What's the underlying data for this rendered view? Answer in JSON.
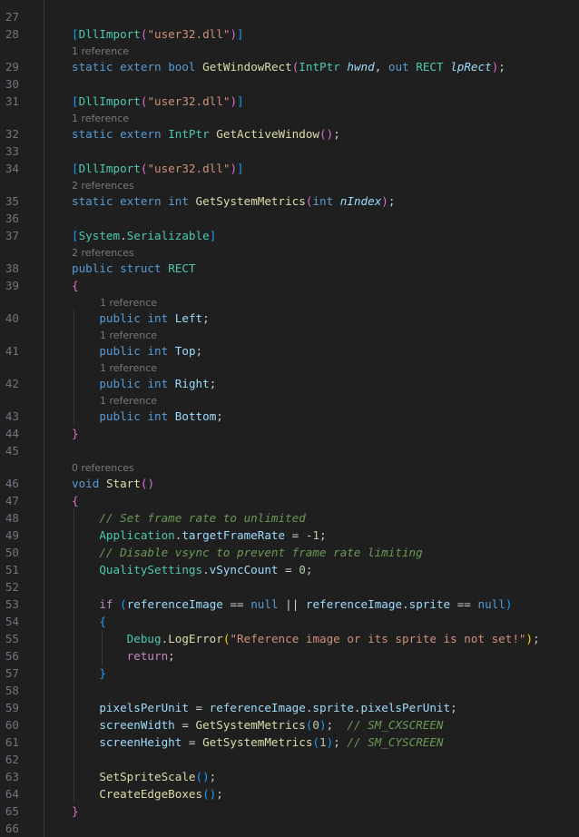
{
  "editor": {
    "language": "csharp",
    "theme_colors": {
      "background": "#1f1f1f",
      "line_number": "#6e7681",
      "keyword": "#569cd6",
      "control_keyword": "#c586c0",
      "type": "#4ec9b0",
      "function": "#dcdcaa",
      "string": "#ce9178",
      "number": "#b5cea8",
      "variable": "#9cdcfe",
      "comment": "#6a9955",
      "codelens": "#7a7a7a",
      "bracket_level_1": "#ffd700",
      "bracket_level_2": "#da70d6",
      "bracket_level_3": "#179fff"
    },
    "lines": [
      {
        "n": "",
        "tokens": []
      },
      {
        "n": "27",
        "tokens": []
      },
      {
        "n": "28",
        "tokens": [
          [
            "b3",
            "["
          ],
          [
            "type",
            "DllImport"
          ],
          [
            "b2",
            "("
          ],
          [
            "str",
            "\"user32.dll\""
          ],
          [
            "b2",
            ")"
          ],
          [
            "b3",
            "]"
          ]
        ]
      },
      {
        "n": "29",
        "tokens": [
          [
            "kw",
            "static"
          ],
          [
            "pl",
            " "
          ],
          [
            "kw",
            "extern"
          ],
          [
            "pl",
            " "
          ],
          [
            "kw",
            "bool"
          ],
          [
            "pl",
            " "
          ],
          [
            "fn",
            "GetWindowRect"
          ],
          [
            "b2",
            "("
          ],
          [
            "type",
            "IntPtr"
          ],
          [
            "pl",
            " "
          ],
          [
            "par",
            "hwnd"
          ],
          [
            "pl",
            ", "
          ],
          [
            "kw",
            "out"
          ],
          [
            "pl",
            " "
          ],
          [
            "type",
            "RECT"
          ],
          [
            "pl",
            " "
          ],
          [
            "par",
            "lpRect"
          ],
          [
            "b2",
            ")"
          ],
          [
            "pl",
            ";"
          ]
        ]
      },
      {
        "n": "30",
        "tokens": []
      },
      {
        "n": "31",
        "tokens": [
          [
            "b3",
            "["
          ],
          [
            "type",
            "DllImport"
          ],
          [
            "b2",
            "("
          ],
          [
            "str",
            "\"user32.dll\""
          ],
          [
            "b2",
            ")"
          ],
          [
            "b3",
            "]"
          ]
        ]
      },
      {
        "n": "32",
        "tokens": [
          [
            "kw",
            "static"
          ],
          [
            "pl",
            " "
          ],
          [
            "kw",
            "extern"
          ],
          [
            "pl",
            " "
          ],
          [
            "type",
            "IntPtr"
          ],
          [
            "pl",
            " "
          ],
          [
            "fn",
            "GetActiveWindow"
          ],
          [
            "b2",
            "()"
          ],
          [
            "pl",
            ";"
          ]
        ]
      },
      {
        "n": "33",
        "tokens": []
      },
      {
        "n": "34",
        "tokens": [
          [
            "b3",
            "["
          ],
          [
            "type",
            "DllImport"
          ],
          [
            "b2",
            "("
          ],
          [
            "str",
            "\"user32.dll\""
          ],
          [
            "b2",
            ")"
          ],
          [
            "b3",
            "]"
          ]
        ]
      },
      {
        "n": "35",
        "tokens": [
          [
            "kw",
            "static"
          ],
          [
            "pl",
            " "
          ],
          [
            "kw",
            "extern"
          ],
          [
            "pl",
            " "
          ],
          [
            "kw",
            "int"
          ],
          [
            "pl",
            " "
          ],
          [
            "fn",
            "GetSystemMetrics"
          ],
          [
            "b2",
            "("
          ],
          [
            "kw",
            "int"
          ],
          [
            "pl",
            " "
          ],
          [
            "par",
            "nIndex"
          ],
          [
            "b2",
            ")"
          ],
          [
            "pl",
            ";"
          ]
        ]
      },
      {
        "n": "36",
        "tokens": []
      },
      {
        "n": "37",
        "tokens": [
          [
            "b3",
            "["
          ],
          [
            "type",
            "System"
          ],
          [
            "pl",
            "."
          ],
          [
            "type",
            "Serializable"
          ],
          [
            "b3",
            "]"
          ]
        ]
      },
      {
        "n": "38",
        "tokens": [
          [
            "kw",
            "public"
          ],
          [
            "pl",
            " "
          ],
          [
            "kw",
            "struct"
          ],
          [
            "pl",
            " "
          ],
          [
            "type",
            "RECT"
          ]
        ]
      },
      {
        "n": "39",
        "tokens": [
          [
            "b2",
            "{"
          ]
        ]
      },
      {
        "n": "40",
        "tokens": [
          [
            "pl",
            "    "
          ],
          [
            "kw",
            "public"
          ],
          [
            "pl",
            " "
          ],
          [
            "kw",
            "int"
          ],
          [
            "pl",
            " "
          ],
          [
            "prop",
            "Left"
          ],
          [
            "pl",
            ";"
          ]
        ]
      },
      {
        "n": "41",
        "tokens": [
          [
            "pl",
            "    "
          ],
          [
            "kw",
            "public"
          ],
          [
            "pl",
            " "
          ],
          [
            "kw",
            "int"
          ],
          [
            "pl",
            " "
          ],
          [
            "prop",
            "Top"
          ],
          [
            "pl",
            ";"
          ]
        ]
      },
      {
        "n": "42",
        "tokens": [
          [
            "pl",
            "    "
          ],
          [
            "kw",
            "public"
          ],
          [
            "pl",
            " "
          ],
          [
            "kw",
            "int"
          ],
          [
            "pl",
            " "
          ],
          [
            "prop",
            "Right"
          ],
          [
            "pl",
            ";"
          ]
        ]
      },
      {
        "n": "43",
        "tokens": [
          [
            "pl",
            "    "
          ],
          [
            "kw",
            "public"
          ],
          [
            "pl",
            " "
          ],
          [
            "kw",
            "int"
          ],
          [
            "pl",
            " "
          ],
          [
            "prop",
            "Bottom"
          ],
          [
            "pl",
            ";"
          ]
        ]
      },
      {
        "n": "44",
        "tokens": [
          [
            "b2",
            "}"
          ]
        ]
      },
      {
        "n": "45",
        "tokens": []
      },
      {
        "n": "46",
        "tokens": [
          [
            "kw",
            "void"
          ],
          [
            "pl",
            " "
          ],
          [
            "fn",
            "Start"
          ],
          [
            "b2",
            "()"
          ]
        ]
      },
      {
        "n": "47",
        "tokens": [
          [
            "b2",
            "{"
          ]
        ]
      },
      {
        "n": "48",
        "tokens": [
          [
            "pl",
            "    "
          ],
          [
            "cmt",
            "// Set frame rate to unlimited"
          ]
        ]
      },
      {
        "n": "49",
        "tokens": [
          [
            "pl",
            "    "
          ],
          [
            "type",
            "Application"
          ],
          [
            "pl",
            "."
          ],
          [
            "prop",
            "targetFrameRate"
          ],
          [
            "pl",
            " = -"
          ],
          [
            "num",
            "1"
          ],
          [
            "pl",
            ";"
          ]
        ]
      },
      {
        "n": "50",
        "tokens": [
          [
            "pl",
            "    "
          ],
          [
            "cmt",
            "// Disable vsync to prevent frame rate limiting"
          ]
        ]
      },
      {
        "n": "51",
        "tokens": [
          [
            "pl",
            "    "
          ],
          [
            "type",
            "QualitySettings"
          ],
          [
            "pl",
            "."
          ],
          [
            "prop",
            "vSyncCount"
          ],
          [
            "pl",
            " = "
          ],
          [
            "num",
            "0"
          ],
          [
            "pl",
            ";"
          ]
        ]
      },
      {
        "n": "52",
        "tokens": []
      },
      {
        "n": "53",
        "tokens": [
          [
            "pl",
            "    "
          ],
          [
            "ctl",
            "if"
          ],
          [
            "pl",
            " "
          ],
          [
            "b3",
            "("
          ],
          [
            "prop",
            "referenceImage"
          ],
          [
            "pl",
            " == "
          ],
          [
            "kw",
            "null"
          ],
          [
            "pl",
            " || "
          ],
          [
            "prop",
            "referenceImage"
          ],
          [
            "pl",
            "."
          ],
          [
            "prop",
            "sprite"
          ],
          [
            "pl",
            " == "
          ],
          [
            "kw",
            "null"
          ],
          [
            "b3",
            ")"
          ]
        ]
      },
      {
        "n": "54",
        "tokens": [
          [
            "pl",
            "    "
          ],
          [
            "b3",
            "{"
          ]
        ]
      },
      {
        "n": "55",
        "tokens": [
          [
            "pl",
            "        "
          ],
          [
            "type",
            "Debug"
          ],
          [
            "pl",
            "."
          ],
          [
            "fn",
            "LogError"
          ],
          [
            "b1",
            "("
          ],
          [
            "str",
            "\"Reference image or its sprite is not set!\""
          ],
          [
            "b1",
            ")"
          ],
          [
            "pl",
            ";"
          ]
        ]
      },
      {
        "n": "56",
        "tokens": [
          [
            "pl",
            "        "
          ],
          [
            "ctl",
            "return"
          ],
          [
            "pl",
            ";"
          ]
        ]
      },
      {
        "n": "57",
        "tokens": [
          [
            "pl",
            "    "
          ],
          [
            "b3",
            "}"
          ]
        ]
      },
      {
        "n": "58",
        "tokens": []
      },
      {
        "n": "59",
        "tokens": [
          [
            "pl",
            "    "
          ],
          [
            "prop",
            "pixelsPerUnit"
          ],
          [
            "pl",
            " = "
          ],
          [
            "prop",
            "referenceImage"
          ],
          [
            "pl",
            "."
          ],
          [
            "prop",
            "sprite"
          ],
          [
            "pl",
            "."
          ],
          [
            "prop",
            "pixelsPerUnit"
          ],
          [
            "pl",
            ";"
          ]
        ]
      },
      {
        "n": "60",
        "tokens": [
          [
            "pl",
            "    "
          ],
          [
            "prop",
            "screenWidth"
          ],
          [
            "pl",
            " = "
          ],
          [
            "fn",
            "GetSystemMetrics"
          ],
          [
            "b3",
            "("
          ],
          [
            "num",
            "0"
          ],
          [
            "b3",
            ")"
          ],
          [
            "pl",
            ";  "
          ],
          [
            "cmt",
            "// SM_CXSCREEN"
          ]
        ]
      },
      {
        "n": "61",
        "tokens": [
          [
            "pl",
            "    "
          ],
          [
            "prop",
            "screenHeight"
          ],
          [
            "pl",
            " = "
          ],
          [
            "fn",
            "GetSystemMetrics"
          ],
          [
            "b3",
            "("
          ],
          [
            "num",
            "1"
          ],
          [
            "b3",
            ")"
          ],
          [
            "pl",
            "; "
          ],
          [
            "cmt",
            "// SM_CYSCREEN"
          ]
        ]
      },
      {
        "n": "62",
        "tokens": []
      },
      {
        "n": "63",
        "tokens": [
          [
            "pl",
            "    "
          ],
          [
            "fn",
            "SetSpriteScale"
          ],
          [
            "b3",
            "()"
          ],
          [
            "pl",
            ";"
          ]
        ]
      },
      {
        "n": "64",
        "tokens": [
          [
            "pl",
            "    "
          ],
          [
            "fn",
            "CreateEdgeBoxes"
          ],
          [
            "b3",
            "()"
          ],
          [
            "pl",
            ";"
          ]
        ]
      },
      {
        "n": "65",
        "tokens": [
          [
            "b2",
            "}"
          ]
        ]
      },
      {
        "n": "66",
        "tokens": []
      }
    ],
    "codelens": [
      {
        "before": "29",
        "text": "1 reference"
      },
      {
        "before": "32",
        "text": "1 reference"
      },
      {
        "before": "35",
        "text": "2 references"
      },
      {
        "before": "38",
        "text": "2 references"
      },
      {
        "before": "40",
        "text": "1 reference"
      },
      {
        "before": "41",
        "text": "1 reference"
      },
      {
        "before": "42",
        "text": "1 reference"
      },
      {
        "before": "43",
        "text": "1 reference"
      },
      {
        "before": "46",
        "text": "0 references"
      }
    ]
  }
}
